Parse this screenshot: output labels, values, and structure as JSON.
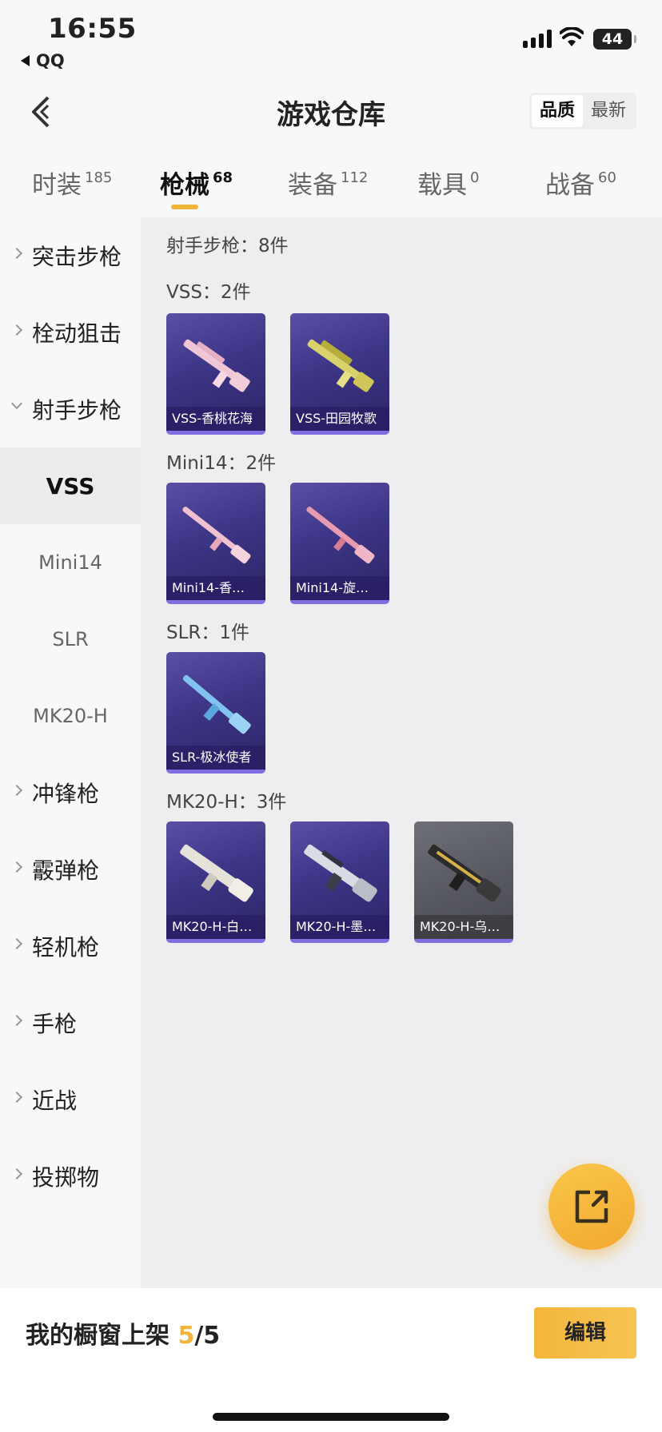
{
  "status": {
    "time": "16:55",
    "back_app": "QQ",
    "battery": "44"
  },
  "header": {
    "title": "游戏仓库",
    "sort_options": [
      "品质",
      "最新"
    ],
    "sort_active": "品质"
  },
  "tabs": [
    {
      "label": "时装",
      "count": "185"
    },
    {
      "label": "枪械",
      "count": "68"
    },
    {
      "label": "装备",
      "count": "112"
    },
    {
      "label": "载具",
      "count": "0"
    },
    {
      "label": "战备",
      "count": "60"
    }
  ],
  "sidebar": {
    "cats": [
      "突击步枪",
      "栓动狙击",
      "射手步枪",
      "冲锋枪",
      "霰弹枪",
      "轻机枪",
      "手枪",
      "近战",
      "投掷物"
    ],
    "subs": [
      "VSS",
      "Mini14",
      "SLR",
      "MK20-H"
    ]
  },
  "content": {
    "section_total": "射手步枪：8件",
    "groups": [
      {
        "title": "VSS：2件",
        "items": [
          "VSS-香桃花海",
          "VSS-田园牧歌"
        ]
      },
      {
        "title": "Mini14：2件",
        "items": [
          "Mini14-香…",
          "Mini14-旋…"
        ]
      },
      {
        "title": "SLR：1件",
        "items": [
          "SLR-极冰使者"
        ]
      },
      {
        "title": "MK20-H：3件",
        "items": [
          "MK20-H-白…",
          "MK20-H-墨…",
          "MK20-H-乌…"
        ]
      }
    ]
  },
  "bottom": {
    "shelf_label": "我的橱窗上架",
    "shelf_current": "5",
    "shelf_total": "/5",
    "edit_label": "编辑"
  },
  "colors": {
    "accent": "#f2b43a",
    "card_purple": "#3d3586",
    "card_grey": "#55565e"
  }
}
